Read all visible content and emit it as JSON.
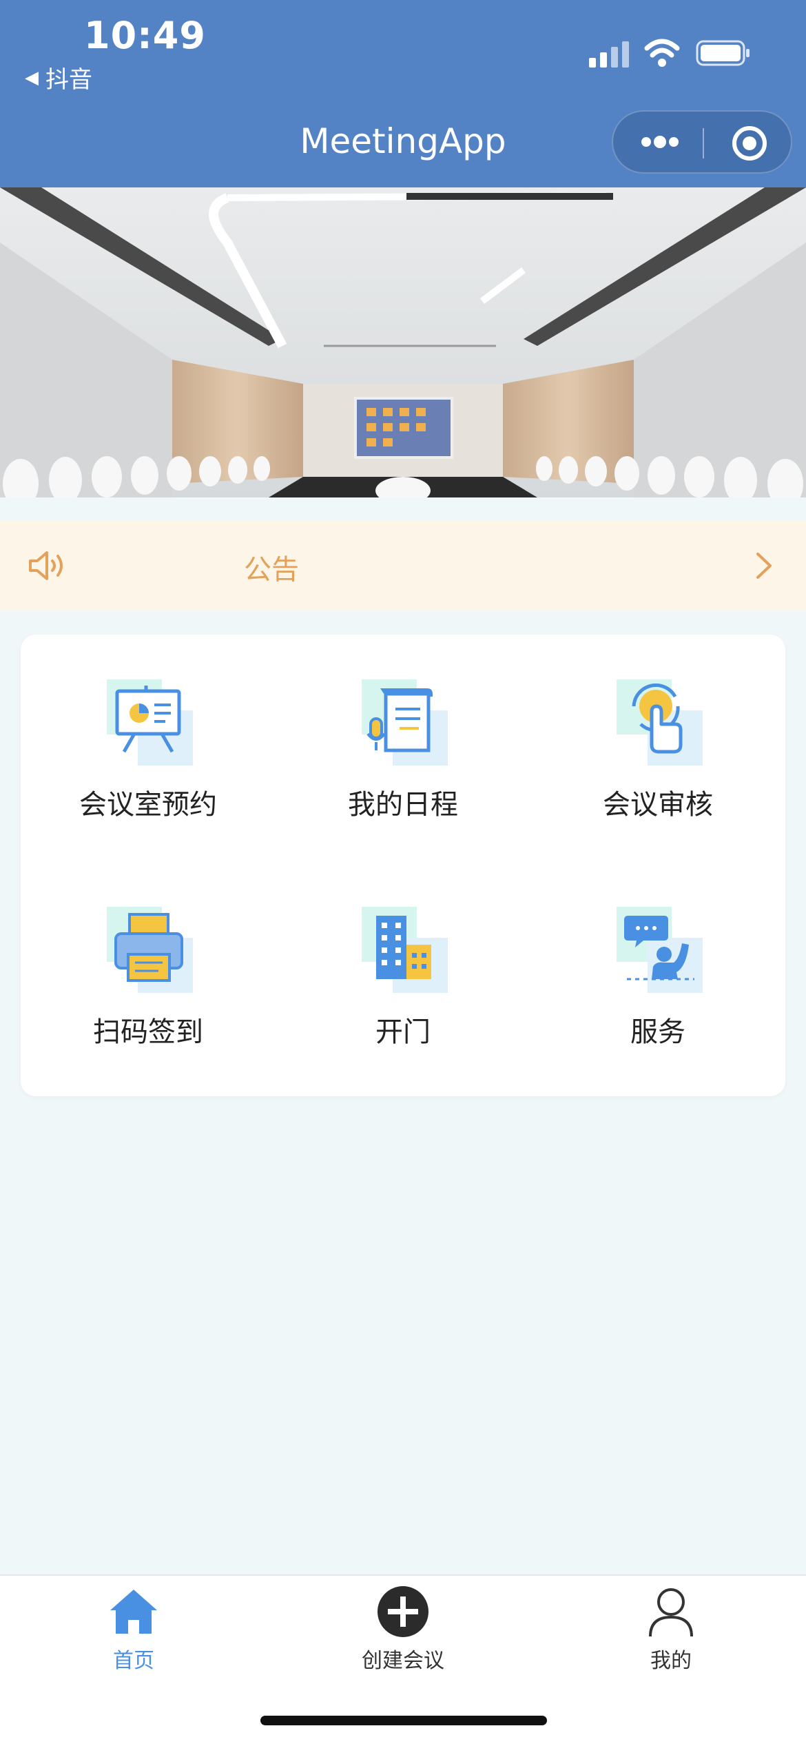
{
  "status_bar": {
    "time": "10:49",
    "back_app": "抖音"
  },
  "nav": {
    "title": "MeetingApp",
    "more_icon": "more-dots-icon",
    "close_icon": "target-circle-icon"
  },
  "banner": {
    "description_icon": "conference-room-image"
  },
  "notice": {
    "icon": "speaker-icon",
    "label": "公告",
    "color": "#e4a15a"
  },
  "features": [
    {
      "label": "会议室预约",
      "icon": "presentation-board-icon"
    },
    {
      "label": "我的日程",
      "icon": "schedule-document-icon"
    },
    {
      "label": "会议审核",
      "icon": "tap-approve-icon"
    },
    {
      "label": "扫码签到",
      "icon": "printer-icon"
    },
    {
      "label": "开门",
      "icon": "building-icon"
    },
    {
      "label": "服务",
      "icon": "customer-service-icon"
    }
  ],
  "tabbar": {
    "items": [
      {
        "label": "首页",
        "icon": "home-icon",
        "active": true
      },
      {
        "label": "创建会议",
        "icon": "plus-circle-icon",
        "active": false
      },
      {
        "label": "我的",
        "icon": "user-icon",
        "active": false
      }
    ],
    "active_color": "#4a90e2"
  },
  "colors": {
    "header": "#5383c5",
    "background": "#eff7f8",
    "icon_blue": "#4a90e2",
    "icon_yellow": "#f5c542"
  }
}
